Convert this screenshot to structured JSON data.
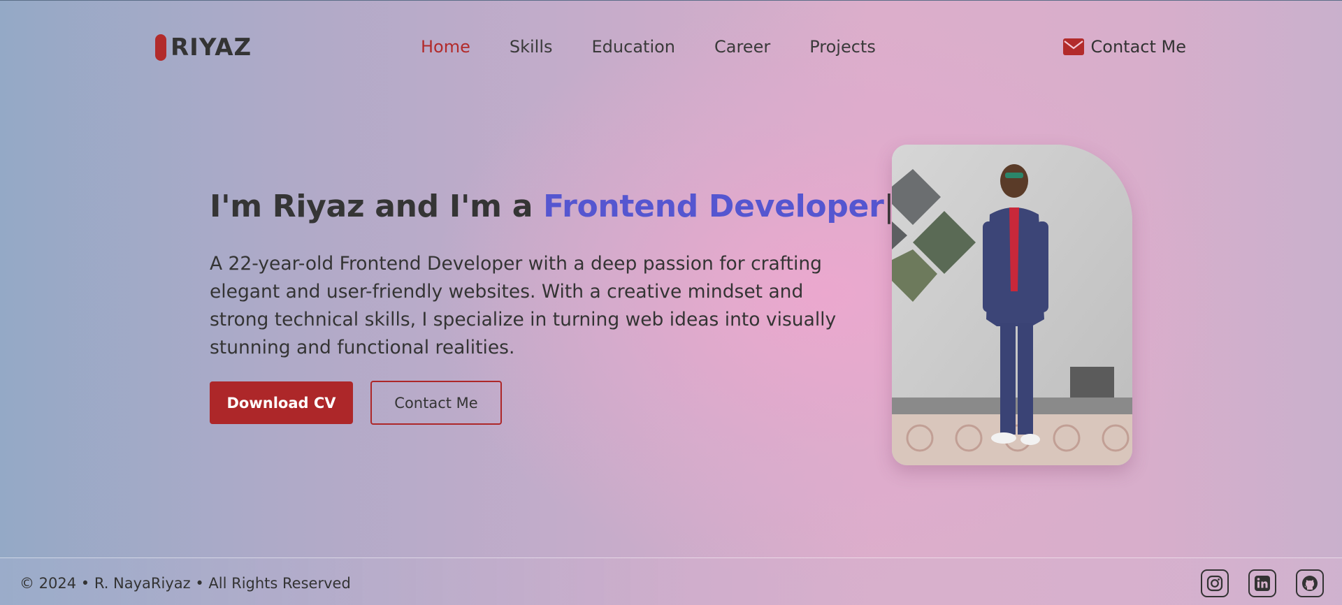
{
  "brand": {
    "name": "RIYAZ"
  },
  "nav": {
    "items": [
      {
        "label": "Home",
        "active": true
      },
      {
        "label": "Skills"
      },
      {
        "label": "Education"
      },
      {
        "label": "Career"
      },
      {
        "label": "Projects"
      }
    ],
    "contact_label": "Contact Me",
    "contact_icon": "envelope-icon"
  },
  "hero": {
    "title_prefix": "I'm Riyaz and I'm a ",
    "title_role": "Frontend Developer",
    "caret": "|",
    "description": "A 22-year-old Frontend Developer with a deep passion for crafting elegant and user-friendly websites. With a creative mindset and strong technical skills, I specialize in turning web ideas into visually stunning and functional realities.",
    "download_label": "Download CV",
    "contact_label": "Contact Me"
  },
  "footer": {
    "copyright": "© 2024 • R. NayaRiyaz • All Rights Reserved",
    "socials": [
      "instagram-icon",
      "linkedin-icon",
      "github-icon"
    ]
  },
  "colors": {
    "accent": "#ad2729",
    "role_highlight": "#5556d0",
    "text": "#333333"
  }
}
